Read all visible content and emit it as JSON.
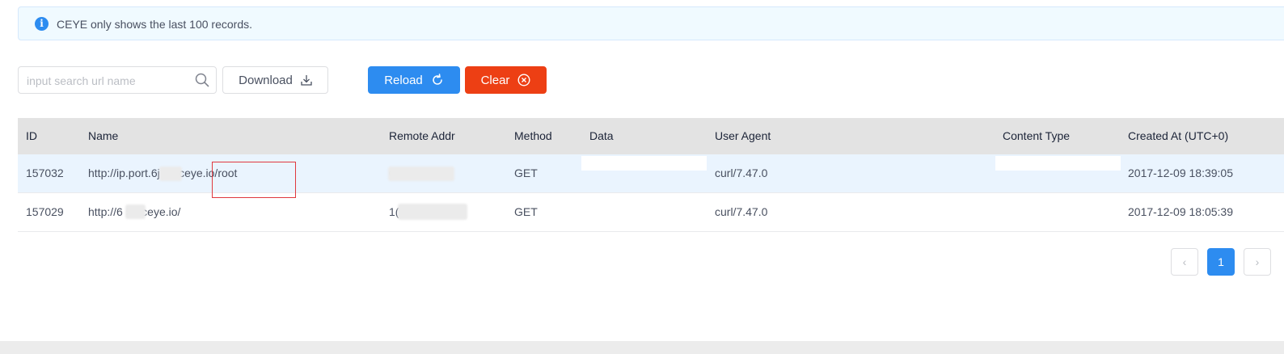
{
  "alert": {
    "icon": "info-icon",
    "icon_glyph": "i",
    "text": "CEYE only shows the last 100 records."
  },
  "toolbar": {
    "search_placeholder": "input search url name",
    "download_label": "Download",
    "reload_label": "Reload",
    "clear_label": "Clear"
  },
  "table": {
    "columns": [
      "ID",
      "Name",
      "Remote Addr",
      "Method",
      "Data",
      "User Agent",
      "Content Type",
      "Created At (UTC+0)"
    ],
    "rows": [
      {
        "id": "157032",
        "name": "http://ip.port.6j   5b.ceye.io/root",
        "remote_addr": "  09",
        "method": "GET",
        "data": "",
        "user_agent": "curl/7.47.0",
        "content_type": "",
        "created": "2017-12-09 18:39:05"
      },
      {
        "id": "157029",
        "name": "http://6   5b.ceye.io/",
        "remote_addr": "1(",
        "method": "GET",
        "data": "",
        "user_agent": "curl/7.47.0",
        "content_type": "",
        "created": "2017-12-09 18:05:39"
      }
    ]
  },
  "pagination": {
    "prev": "‹",
    "current": "1",
    "next": "›"
  },
  "colors": {
    "primary": "#2d8cf0",
    "danger": "#ed3f14",
    "header_bg": "#e3e3e3",
    "highlight_row": "#eaf4fe"
  }
}
